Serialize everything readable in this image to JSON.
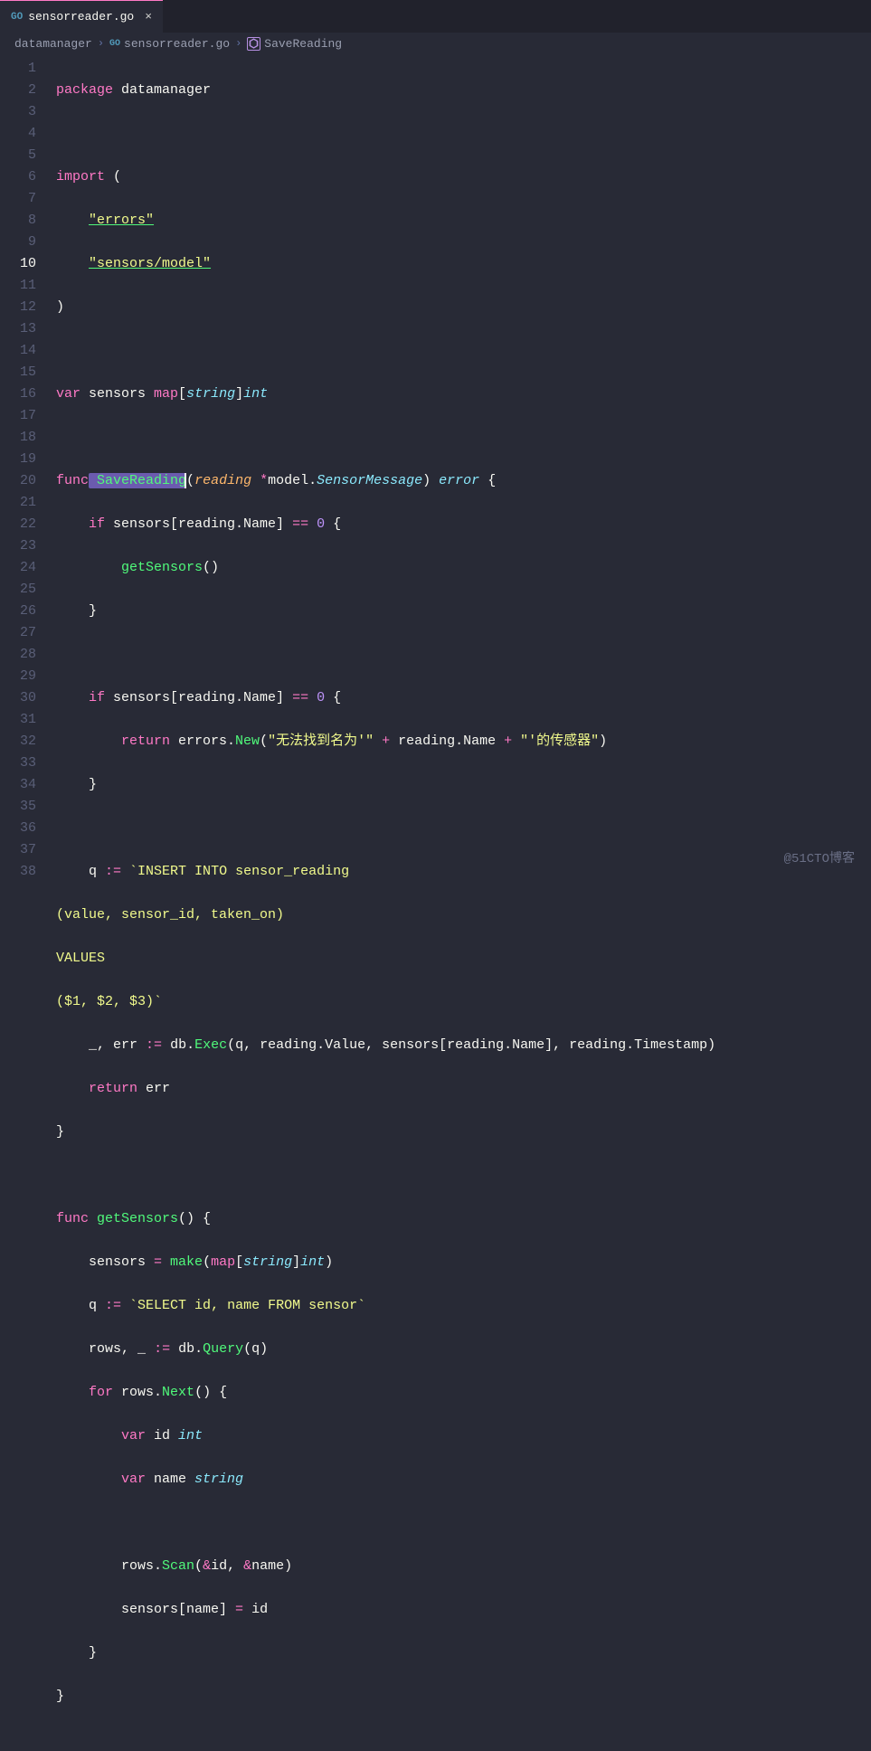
{
  "tab": {
    "filename": "sensorreader.go",
    "icon": "GO"
  },
  "breadcrumb": {
    "folder": "datamanager",
    "file": "sensorreader.go",
    "symbol": "SaveReading"
  },
  "lines": {
    "start": 1,
    "end": 38,
    "active": 10
  },
  "code": {
    "package_kw": "package",
    "package_name": " datamanager",
    "import_kw": "import",
    "import_paren_open": " (",
    "import1": "\"errors\"",
    "import2": "\"sensors/model\"",
    "import_paren_close": ")",
    "var_kw": "var",
    "var_name": " sensors ",
    "map_kw": "map",
    "map_key": "string",
    "map_val": "int",
    "func_kw": "func",
    "save_name": " SaveReading",
    "save_params_open": "(",
    "save_param_name": "reading",
    "save_param_star": " *",
    "save_param_pkg": "model",
    "save_param_dot": ".",
    "save_param_type": "SensorMessage",
    "save_params_close": ") ",
    "error_kw": "error",
    "brace_open": " {",
    "if_kw": "if",
    "sensors_expr_open": " sensors[reading.Name] ",
    "eq": "==",
    "zero": " 0",
    "if_brace": " {",
    "getsensors_call": "getSensors",
    "empty_parens": "()",
    "close_brace": "}",
    "return_kw": "return",
    "errors_pkg": " errors.",
    "new_fn": "New",
    "err_open": "(",
    "err_s1": "\"无法找到名为'\"",
    "plus": " + ",
    "reading_name": "reading.Name",
    "err_s2": "\"'的传感器\"",
    "err_close": ")",
    "q_decl": "q ",
    "assign": ":=",
    "sql1": " `INSERT INTO sensor_reading",
    "sql2": "(value, sensor_id, taken_on)",
    "sql3": "VALUES",
    "sql4": "($1, $2, $3)`",
    "blank": "_",
    "err_var": ", err ",
    "db_exec": " db.",
    "exec_fn": "Exec",
    "exec_args": "(q, reading.Value, sensors[reading.Name], reading.Timestamp)",
    "return_err": " err",
    "getsensors_def": " getSensors",
    "getsensors_parens": "() {",
    "sensors_assign": "sensors ",
    "equals_sp": "= ",
    "make_fn": "make",
    "make_args_open": "(",
    "make_map": "map",
    "make_key": "string",
    "make_val": "int",
    "make_close": ")",
    "select_sql": " `SELECT id, name FROM sensor`",
    "rows": "rows, ",
    "query_fn": "Query",
    "query_args": "(q)",
    "for_kw": "for",
    "rows_next": " rows.",
    "next_fn": "Next",
    "var_id": " id ",
    "int_type": "int",
    "var_name_str": " name ",
    "string_type": "string",
    "rows_scan": "rows.",
    "scan_fn": "Scan",
    "scan_args_open": "(",
    "amp1": "&",
    "id_tok": "id, ",
    "amp2": "&",
    "name_tok": "name)",
    "sensors_name": "sensors[name] ",
    "eq_sp": "= ",
    "id_val": "id"
  },
  "watermark": "@51CTO博客"
}
